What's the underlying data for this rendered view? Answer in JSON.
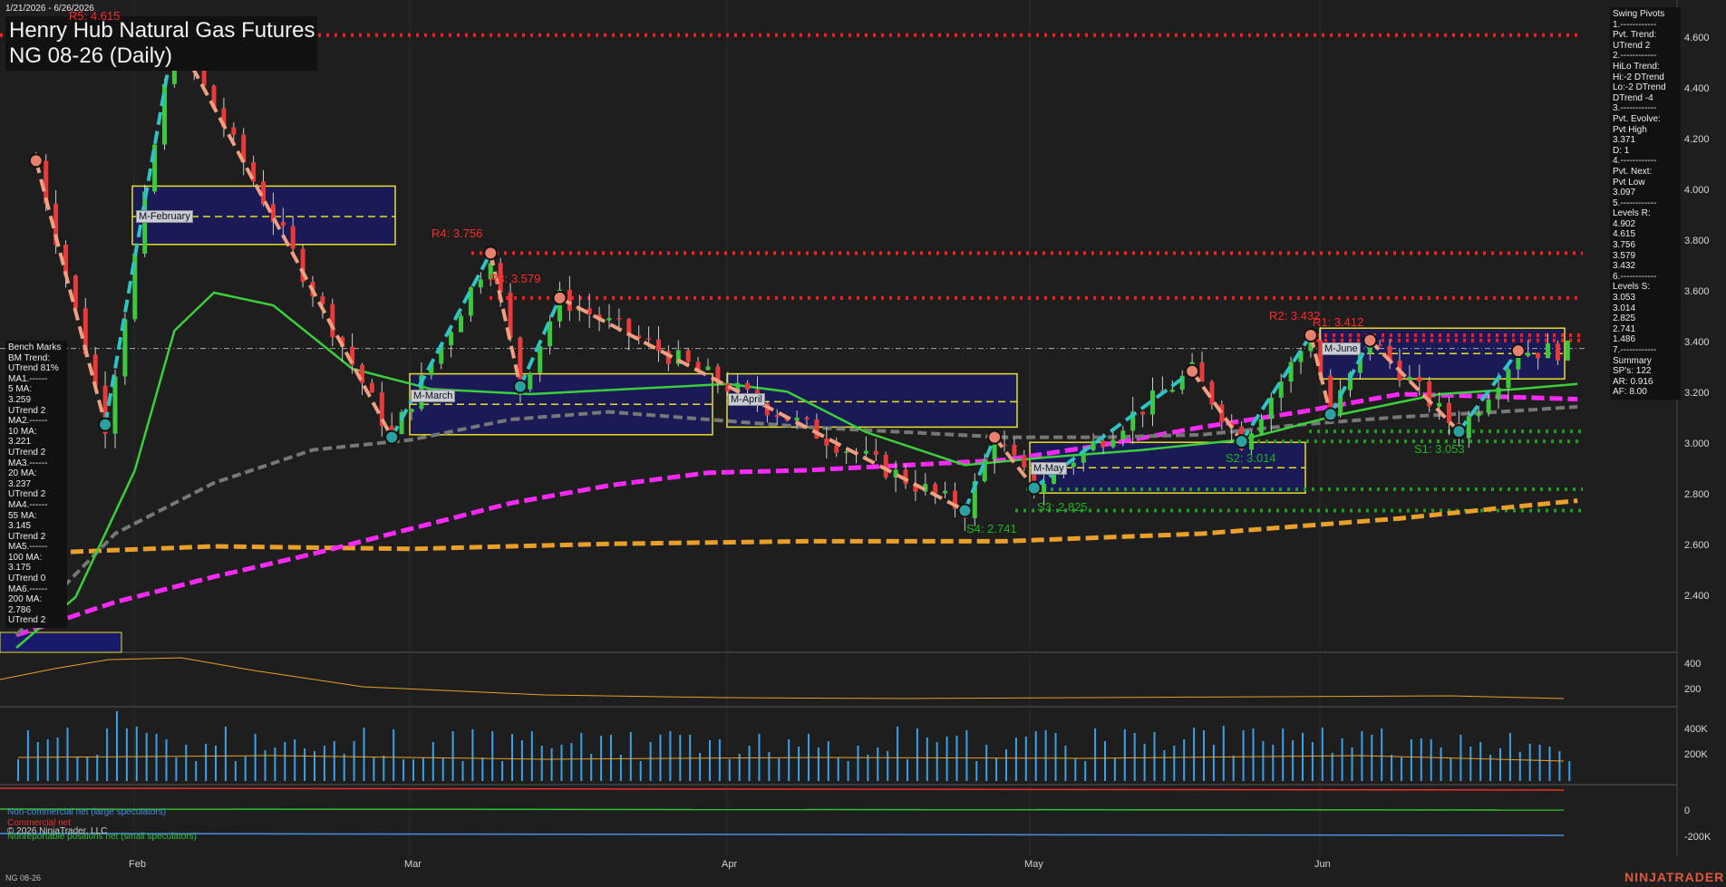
{
  "header": {
    "date_range": "1/21/2026 - 6/26/2026",
    "title_line1": "Henry Hub Natural Gas Futures",
    "title_line2": "NG 08-26 (Daily)",
    "instrument_footer": "NG 08-26",
    "copyright": "© 2026 NinjaTrader, LLC",
    "brand": "NINJATRADER"
  },
  "swing_pivots": [
    "Swing Pivots",
    "1.------------",
    "Pvt. Trend:",
    "UTrend 2",
    "2.------------",
    "HiLo Trend:",
    "Hi:-2 DTrend",
    "Lo:-2 DTrend",
    "DTrend -4",
    "3.------------",
    "Pvt. Evolve:",
    "Pvt High",
    "3.371",
    "D: 1",
    "4.------------",
    "Pvt. Next:",
    "Pvt Low",
    "3.097",
    "5.------------",
    "Levels R:",
    "4.902",
    "4.615",
    "3.756",
    "3.579",
    "3.432",
    "6.------------",
    "Levels S:",
    "3.053",
    "3.014",
    "2.825",
    "2.741",
    "1.486",
    "7.------------",
    "Summary",
    "SP's: 122",
    "AR: 0.916",
    "AF: 8.00"
  ],
  "bench_marks": [
    "Bench Marks",
    "BM Trend:",
    "UTrend 81%",
    "MA1.------",
    "5 MA:",
    "3.259",
    "UTrend 2",
    "MA2.------",
    "10 MA:",
    "3.221",
    "UTrend 2",
    "MA3.------",
    "20 MA:",
    "3.237",
    "UTrend 2",
    "MA4.------",
    "55 MA:",
    "3.145",
    "UTrend 2",
    "MA5.------",
    "100 MA:",
    "3.175",
    "UTrend 0",
    "MA6.------",
    "200 MA:",
    "2.786",
    "UTrend 2"
  ],
  "level_labels": {
    "r5": "R5: 4.615",
    "r4": "R4: 3.756",
    "r3": "R3: 3.579",
    "r2": "R2: 3.432",
    "r1": "R1: 3.412",
    "s1": "S1: 3.053",
    "s2": "S2: 3.014",
    "s3": "S3: 2.825",
    "s4": "S4: 2.741"
  },
  "monthly_labels": [
    "M-February",
    "M-March",
    "M-April",
    "M-May",
    "M-June"
  ],
  "month_ticks": [
    "Feb",
    "Mar",
    "Apr",
    "May",
    "Jun"
  ],
  "cot_legend": {
    "noncommercial": "Non-commercial net (large speculators)",
    "commercial": "Commercial net",
    "nonreportable": "Nonreportable positions net (small speculators)"
  },
  "colors": {
    "resistance": "#ff1e1e",
    "support": "#1e9e1e",
    "up_candle": "#3cc83c",
    "down_candle": "#e83a3a",
    "swing_up": "#2ec4c4",
    "swing_down": "#f0a080",
    "ma_fast": "#3ccf3c",
    "ma_magenta": "#ff2aff",
    "ma_orange": "#e8a02a",
    "ma_gray": "#777777",
    "monthly_box": "#1a1a6a"
  },
  "chart_data": {
    "type": "candlestick",
    "title": "NG 08-26 (Daily)",
    "ylabel": "",
    "xlabel": "",
    "x": [
      "Feb",
      "Mar",
      "Apr",
      "May",
      "Jun"
    ],
    "ylim": [
      2.2,
      4.7
    ],
    "y_ticks": [
      2.4,
      2.6,
      2.8,
      3.0,
      3.2,
      3.4,
      3.6,
      3.8,
      4.0,
      4.2,
      4.4,
      4.6
    ],
    "current_price": 3.38,
    "resistance_levels": [
      4.615,
      3.756,
      3.579,
      3.432,
      3.412
    ],
    "support_levels": [
      3.053,
      3.014,
      2.825,
      2.741
    ],
    "swing_points": [
      {
        "d": 2,
        "v": 4.12,
        "t": "H"
      },
      {
        "d": 9,
        "v": 3.08,
        "t": "L"
      },
      {
        "d": 16,
        "v": 4.62,
        "t": "H"
      },
      {
        "d": 38,
        "v": 3.03,
        "t": "L"
      },
      {
        "d": 48,
        "v": 3.756,
        "t": "H"
      },
      {
        "d": 51,
        "v": 3.23,
        "t": "L"
      },
      {
        "d": 55,
        "v": 3.579,
        "t": "H"
      },
      {
        "d": 96,
        "v": 2.741,
        "t": "L"
      },
      {
        "d": 99,
        "v": 3.03,
        "t": "H"
      },
      {
        "d": 103,
        "v": 2.83,
        "t": "L"
      },
      {
        "d": 119,
        "v": 3.29,
        "t": "H"
      },
      {
        "d": 124,
        "v": 3.014,
        "t": "L"
      },
      {
        "d": 131,
        "v": 3.432,
        "t": "H"
      },
      {
        "d": 133,
        "v": 3.12,
        "t": "L"
      },
      {
        "d": 137,
        "v": 3.412,
        "t": "H"
      },
      {
        "d": 146,
        "v": 3.053,
        "t": "L"
      },
      {
        "d": 152,
        "v": 3.371,
        "t": "H"
      }
    ],
    "monthly_ranges": [
      {
        "name": "M-February",
        "hi": 4.02,
        "lo": 3.79,
        "mid": 3.9
      },
      {
        "name": "M-March",
        "hi": 3.28,
        "lo": 3.04,
        "mid": 3.16
      },
      {
        "name": "M-April",
        "hi": 3.28,
        "lo": 3.07,
        "mid": 3.17
      },
      {
        "name": "M-May",
        "hi": 3.01,
        "lo": 2.81,
        "mid": 2.91
      },
      {
        "name": "M-June",
        "hi": 3.46,
        "lo": 3.26,
        "mid": 3.36
      }
    ],
    "moving_averages": {
      "ma20": [
        [
          0,
          2.2
        ],
        [
          6,
          2.4
        ],
        [
          12,
          2.9
        ],
        [
          16,
          3.45
        ],
        [
          20,
          3.6
        ],
        [
          26,
          3.55
        ],
        [
          34,
          3.3
        ],
        [
          42,
          3.22
        ],
        [
          52,
          3.2
        ],
        [
          62,
          3.22
        ],
        [
          72,
          3.24
        ],
        [
          78,
          3.21
        ],
        [
          86,
          3.05
        ],
        [
          96,
          2.92
        ],
        [
          104,
          2.95
        ],
        [
          114,
          2.98
        ],
        [
          124,
          3.02
        ],
        [
          134,
          3.12
        ],
        [
          144,
          3.2
        ],
        [
          152,
          3.22
        ],
        [
          158,
          3.24
        ]
      ],
      "ma55": [
        [
          0,
          2.25
        ],
        [
          10,
          2.65
        ],
        [
          20,
          2.85
        ],
        [
          30,
          2.98
        ],
        [
          40,
          3.02
        ],
        [
          50,
          3.1
        ],
        [
          60,
          3.13
        ],
        [
          70,
          3.1
        ],
        [
          80,
          3.07
        ],
        [
          90,
          3.05
        ],
        [
          100,
          3.03
        ],
        [
          110,
          3.03
        ],
        [
          120,
          3.04
        ],
        [
          130,
          3.08
        ],
        [
          140,
          3.11
        ],
        [
          150,
          3.13
        ],
        [
          158,
          3.15
        ]
      ],
      "ma100": [
        [
          0,
          2.25
        ],
        [
          10,
          2.38
        ],
        [
          20,
          2.48
        ],
        [
          30,
          2.57
        ],
        [
          40,
          2.67
        ],
        [
          50,
          2.77
        ],
        [
          60,
          2.84
        ],
        [
          70,
          2.89
        ],
        [
          80,
          2.9
        ],
        [
          90,
          2.92
        ],
        [
          100,
          2.94
        ],
        [
          110,
          3.0
        ],
        [
          120,
          3.07
        ],
        [
          130,
          3.13
        ],
        [
          140,
          3.2
        ],
        [
          150,
          3.19
        ],
        [
          158,
          3.18
        ]
      ],
      "ma200": [
        [
          0,
          2.57
        ],
        [
          20,
          2.6
        ],
        [
          40,
          2.59
        ],
        [
          60,
          2.61
        ],
        [
          80,
          2.62
        ],
        [
          100,
          2.62
        ],
        [
          120,
          2.65
        ],
        [
          140,
          2.71
        ],
        [
          150,
          2.75
        ],
        [
          158,
          2.78
        ]
      ]
    },
    "ranges": {
      "ymin_data": 2.2,
      "ymax_data": 4.7
    }
  }
}
